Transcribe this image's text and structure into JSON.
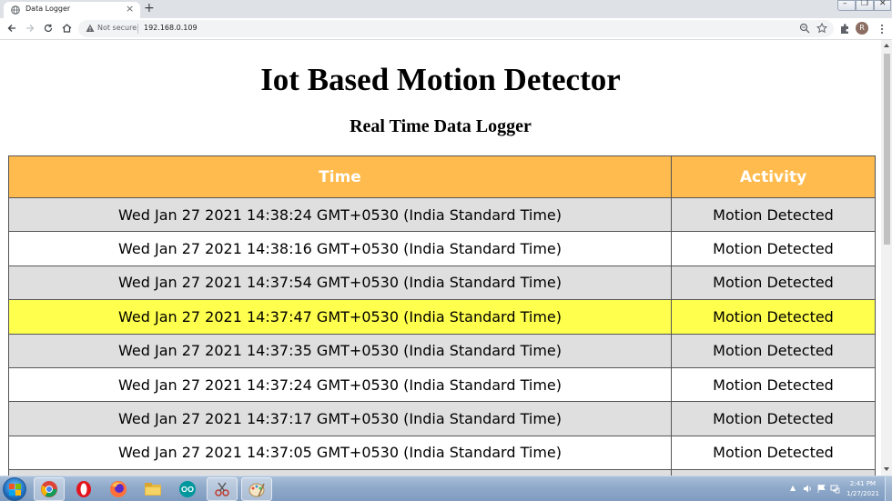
{
  "browser": {
    "tab_title": "Data Logger",
    "tab_close": "×",
    "new_tab": "+",
    "security_label": "Not secure",
    "url": "192.168.0.109",
    "profile_initial": "R"
  },
  "page": {
    "title": "Iot Based Motion Detector",
    "subtitle": "Real Time Data Logger",
    "table": {
      "headers": [
        "Time",
        "Activity"
      ],
      "highlighted_row": 3,
      "rows": [
        [
          "Wed Jan 27 2021 14:38:24 GMT+0530 (India Standard Time)",
          "Motion Detected"
        ],
        [
          "Wed Jan 27 2021 14:38:16 GMT+0530 (India Standard Time)",
          "Motion Detected"
        ],
        [
          "Wed Jan 27 2021 14:37:54 GMT+0530 (India Standard Time)",
          "Motion Detected"
        ],
        [
          "Wed Jan 27 2021 14:37:47 GMT+0530 (India Standard Time)",
          "Motion Detected"
        ],
        [
          "Wed Jan 27 2021 14:37:35 GMT+0530 (India Standard Time)",
          "Motion Detected"
        ],
        [
          "Wed Jan 27 2021 14:37:24 GMT+0530 (India Standard Time)",
          "Motion Detected"
        ],
        [
          "Wed Jan 27 2021 14:37:17 GMT+0530 (India Standard Time)",
          "Motion Detected"
        ],
        [
          "Wed Jan 27 2021 14:37:05 GMT+0530 (India Standard Time)",
          "Motion Detected"
        ],
        [
          "",
          ""
        ]
      ]
    },
    "colors": {
      "header_bg": "#ffbb4d",
      "odd_row_bg": "#e0dfe0",
      "even_row_bg": "#ffffff",
      "highlight_row_bg": "#ffff4d"
    }
  },
  "taskbar": {
    "apps": [
      "chrome-icon",
      "opera-icon",
      "firefox-icon",
      "file-explorer-icon",
      "arduino-icon",
      "snipping-tool-icon",
      "paint-icon"
    ],
    "clock_time": "2:41 PM",
    "clock_date": "1/27/2021"
  }
}
